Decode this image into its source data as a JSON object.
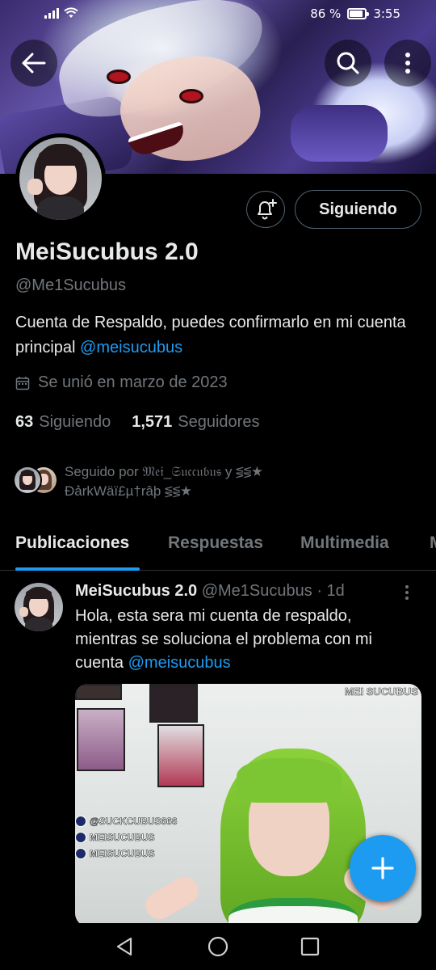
{
  "status_bar": {
    "battery": "86 %",
    "battery_level": 0.86,
    "time": "3:55"
  },
  "header": {
    "back_icon": "arrow-left-icon",
    "search_icon": "search-icon",
    "more_icon": "more-vertical-icon"
  },
  "profile": {
    "display_name": "MeiSucubus 2.0",
    "handle": "@Me1Sucubus",
    "bio_text": "Cuenta de Respaldo, puedes confirmarlo en mi cuenta principal ",
    "bio_link": "@meisucubus",
    "joined": "Se unió en marzo de 2023",
    "following_count": "63",
    "following_label": "Siguiendo",
    "followers_count": "1,571",
    "followers_label": "Seguidores",
    "followed_by_text": "Seguido por 𝔐𝔢𝔦_𝔖𝔲𝔠𝔠𝔲𝔟𝔲𝔰 y ⋚⋚★ ĐảrkWäï£µ†râþ ⋚⋚★",
    "follow_button": "Siguiendo",
    "notify_icon": "bell-plus-icon"
  },
  "tabs": [
    {
      "label": "Publicaciones",
      "active": true
    },
    {
      "label": "Respuestas",
      "active": false
    },
    {
      "label": "Multimedia",
      "active": false
    },
    {
      "label": "M",
      "active": false
    }
  ],
  "post": {
    "author_name": "MeiSucubus 2.0",
    "author_handle": "@Me1Sucubus",
    "time": "· 1d",
    "text": "Hola, esta sera mi cuenta de respaldo, mientras se soluciona el problema con mi cuenta ",
    "text_link": "@meisucubus",
    "media": {
      "watermark": "MEI SUCUBUS",
      "social": [
        {
          "icon": "heart-icon",
          "label": "@SUCKCUBUS666"
        },
        {
          "icon": "instagram-icon",
          "label": "MEISUCUBUS"
        },
        {
          "icon": "x-icon",
          "label": "MEISUCUBUS"
        }
      ]
    }
  },
  "fab": {
    "icon": "plus-icon"
  },
  "nav": {
    "back_icon": "triangle-back-icon",
    "home_icon": "circle-home-icon",
    "recents_icon": "square-recents-icon"
  },
  "colors": {
    "accent": "#1d9bf0",
    "background": "#000000",
    "text_primary": "#e7e9ea",
    "text_secondary": "#71767b"
  }
}
